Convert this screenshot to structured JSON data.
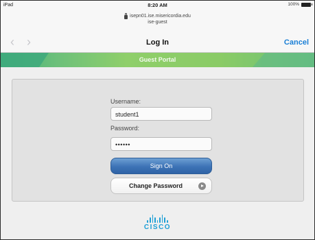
{
  "statusbar": {
    "device": "iPad",
    "time": "8:20 AM",
    "battery": "100%"
  },
  "urlbar": {
    "host": "isepn01.ise.misericordia.edu",
    "network": "ise-guest"
  },
  "navbar": {
    "back_icon": "chevron-left-icon",
    "forward_icon": "chevron-right-icon",
    "title": "Log In",
    "cancel_label": "Cancel"
  },
  "banner": {
    "title": "Guest Portal"
  },
  "login": {
    "username_label": "Username:",
    "username_value": "student1",
    "password_label": "Password:",
    "password_value": "••••••",
    "sign_on_label": "Sign On",
    "change_password_label": "Change Password"
  },
  "footer": {
    "brand": "CISCO"
  },
  "colors": {
    "accent_link": "#1a7fd6",
    "banner_green": "#8acb66",
    "primary_button": "#3d73b6",
    "cisco_blue": "#1d9fd6"
  }
}
